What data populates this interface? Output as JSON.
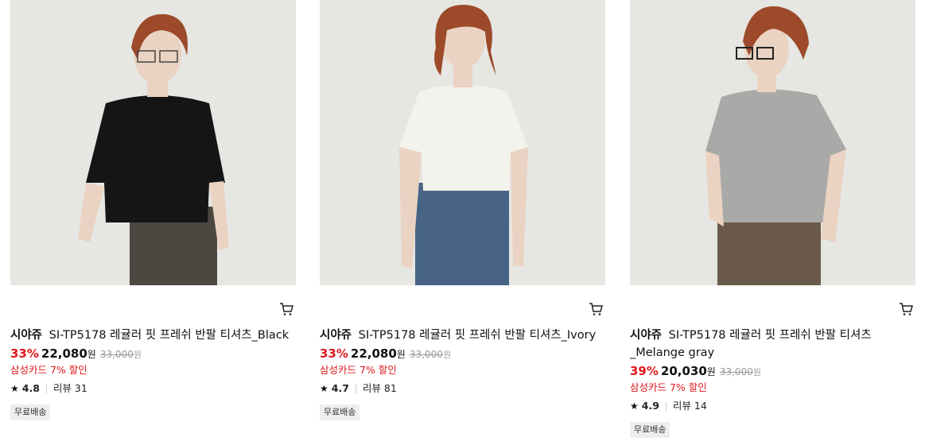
{
  "products": [
    {
      "brand": "시야쥬",
      "name": "SI-TP5178 레귤러 핏 프레쉬 반팔 티셔츠_Black",
      "discount": "33%",
      "price": "22,080",
      "currency": "원",
      "original_price": "33,000",
      "original_currency": "원",
      "card_promo": "삼성카드 7% 할인",
      "rating": "4.8",
      "reviews": "리뷰 31",
      "badge": "무료배송",
      "shirt_color": "#151515",
      "pants_color": "#4c4741"
    },
    {
      "brand": "시야쥬",
      "name": "SI-TP5178 레귤러 핏 프레쉬 반팔 티셔츠_Ivory",
      "discount": "33%",
      "price": "22,080",
      "currency": "원",
      "original_price": "33,000",
      "original_currency": "원",
      "card_promo": "삼성카드 7% 할인",
      "rating": "4.7",
      "reviews": "리뷰 81",
      "badge": "무료배송",
      "shirt_color": "#f4f2ec",
      "pants_color": "#476487"
    },
    {
      "brand": "시야쥬",
      "name": "SI-TP5178 레귤러 핏 프레쉬 반팔 티셔츠",
      "name_line2": "_Melange gray",
      "discount": "39%",
      "price": "20,030",
      "currency": "원",
      "original_price": "33,000",
      "original_currency": "원",
      "card_promo": "삼성카드 7% 할인",
      "rating": "4.9",
      "reviews": "리뷰 14",
      "badge": "무료배송",
      "shirt_color": "#a9a9a7",
      "pants_color": "#6b5a4b"
    }
  ],
  "colors": {
    "discount_red": "#e0181c",
    "photo_bg": "#e6e6e3",
    "hair": "#9c4a2a",
    "skin": "#ead3c2"
  }
}
